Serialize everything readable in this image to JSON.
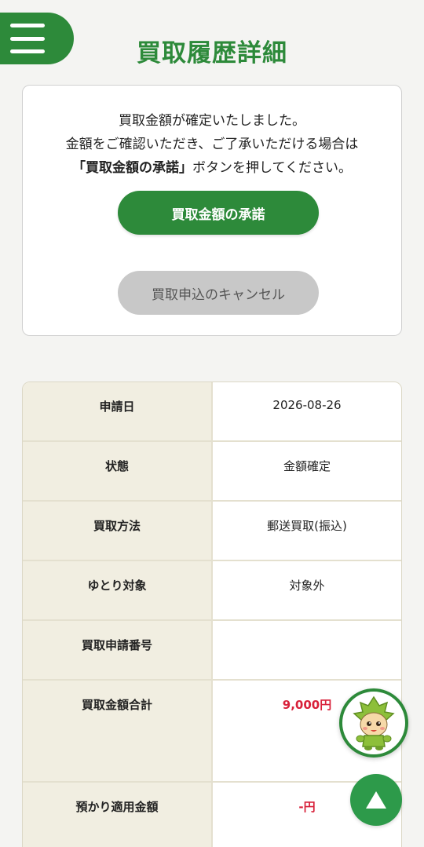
{
  "header": {
    "menu_icon": "hamburger-menu-icon",
    "title": "買取履歴詳細"
  },
  "notice": {
    "line1": "買取金額が確定いたしました。",
    "line2": "金額をご確認いただき、ご了承いただける場合は",
    "line3_bold": "「買取金額の承諾」",
    "line3_rest": "ボタンを押してください。",
    "approve_label": "買取金額の承諾",
    "cancel_label": "買取申込のキャンセル"
  },
  "details": {
    "rows": [
      {
        "label": "申請日",
        "value": "2026-08-26"
      },
      {
        "label": "状態",
        "value": "金額確定"
      },
      {
        "label": "買取方法",
        "value": "郵送買取(振込)"
      },
      {
        "label": "ゆとり対象",
        "value": "対象外"
      },
      {
        "label": "買取申請番号",
        "value": ""
      },
      {
        "label": "買取金額合計",
        "value": "9,000円"
      },
      {
        "label": "預かり適用金額",
        "value": "-円"
      }
    ]
  },
  "floating": {
    "mascot_icon": "mascot-character-icon",
    "scroll_top_icon": "arrow-up-icon"
  },
  "colors": {
    "brand_green": "#2d8a3a",
    "price_red": "#d8213a",
    "label_bg": "#f1eee1"
  }
}
